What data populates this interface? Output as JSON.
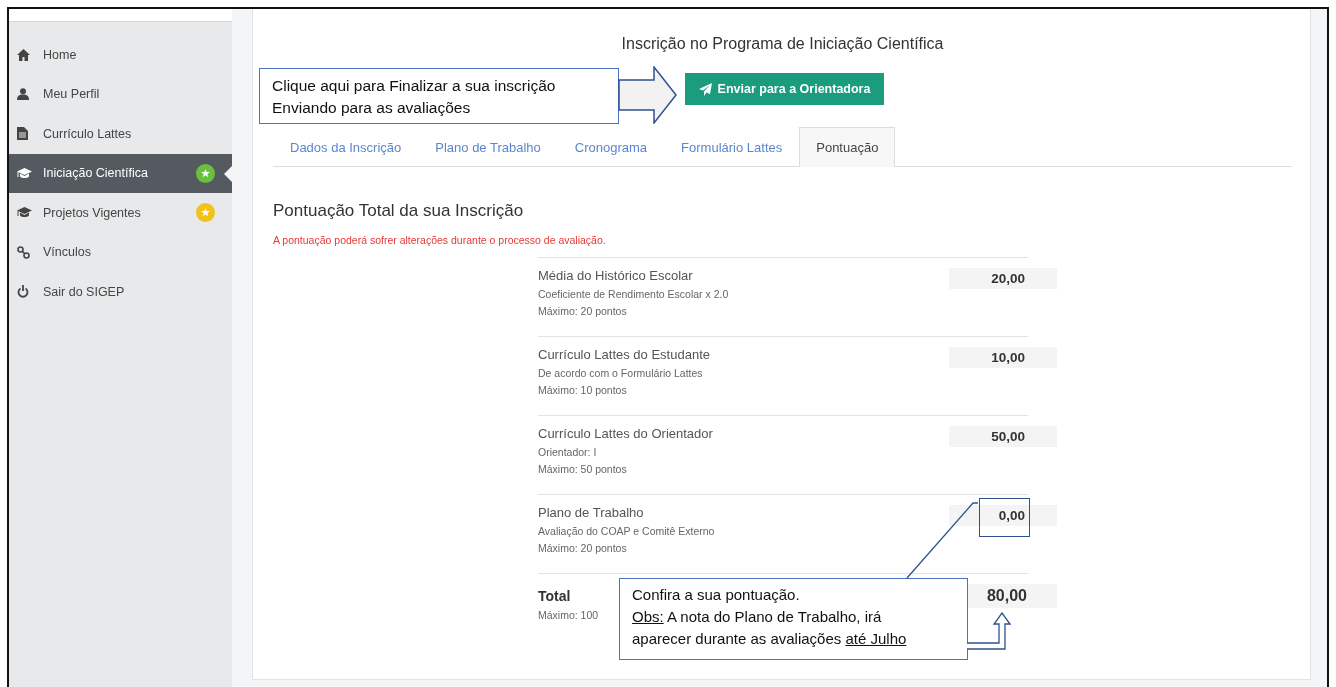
{
  "sidebar": {
    "items": [
      {
        "label": "Home",
        "selected": false
      },
      {
        "label": "Meu Perfil",
        "selected": false
      },
      {
        "label": "Currículo Lattes",
        "selected": false
      },
      {
        "label": "Iniciação Científica",
        "selected": true,
        "color": "#6cbf3c"
      },
      {
        "label": "Projetos Vigentes",
        "selected": false,
        "color": "#f0c21b"
      },
      {
        "label": "Vínculos",
        "selected": false
      },
      {
        "label": "Sair do SIGEP",
        "selected": false
      }
    ]
  },
  "page": {
    "title": "Inscrição no Programa de Iniciação Científica",
    "send_button": "Enviar para a Orientadora",
    "tabs": [
      {
        "label": "Dados da Inscrição",
        "selected": false
      },
      {
        "label": "Plano de Trabalho",
        "selected": false
      },
      {
        "label": "Cronograma",
        "selected": false
      },
      {
        "label": "Formulário Lattes",
        "selected": false
      },
      {
        "label": "Pontuação",
        "selected": true
      }
    ],
    "heading": "Pontuação Total da sua Inscrição",
    "warning": "A pontuação poderá sofrer alterações durante o processo de avaliação.",
    "scores": [
      {
        "label": "Média do Histórico Escolar",
        "description": "Coeficiente de Rendimento Escolar x 2.0",
        "maximum": "Máximo: 20 pontos",
        "value": "20,00"
      },
      {
        "label": "Currículo Lattes do Estudante",
        "description": "De acordo com o Formulário Lattes",
        "maximum": "Máximo: 10 pontos",
        "value": "10,00"
      },
      {
        "label": "Currículo Lattes do Orientador",
        "description": "Orientador: I",
        "maximum": "Máximo: 50 pontos",
        "value": "50,00"
      },
      {
        "label": "Plano de Trabalho",
        "description": "Avaliação do COAP e Comitê Externo",
        "maximum": "Máximo: 20 pontos",
        "value": "0,00"
      }
    ],
    "total": {
      "label": "Total",
      "maximum": "Máximo: 100",
      "value": "80,00"
    }
  },
  "annotations": [
    {
      "lines": [
        [
          {
            "text": "Clique aqui para Finalizar a sua inscrição",
            "underline": false
          }
        ],
        [
          {
            "text": "Enviando para as avaliações",
            "underline": false
          }
        ]
      ]
    },
    {
      "lines": [
        [
          {
            "text": "Confira a sua pontuação.",
            "underline": false
          }
        ],
        [
          {
            "text": "Obs:",
            "underline": true
          },
          {
            "text": " A nota do Plano de Trabalho, irá",
            "underline": false
          }
        ],
        [
          {
            "text": "aparecer durante as avaliações ",
            "underline": false
          },
          {
            "text": "até Julho",
            "underline": true
          }
        ]
      ]
    }
  ]
}
